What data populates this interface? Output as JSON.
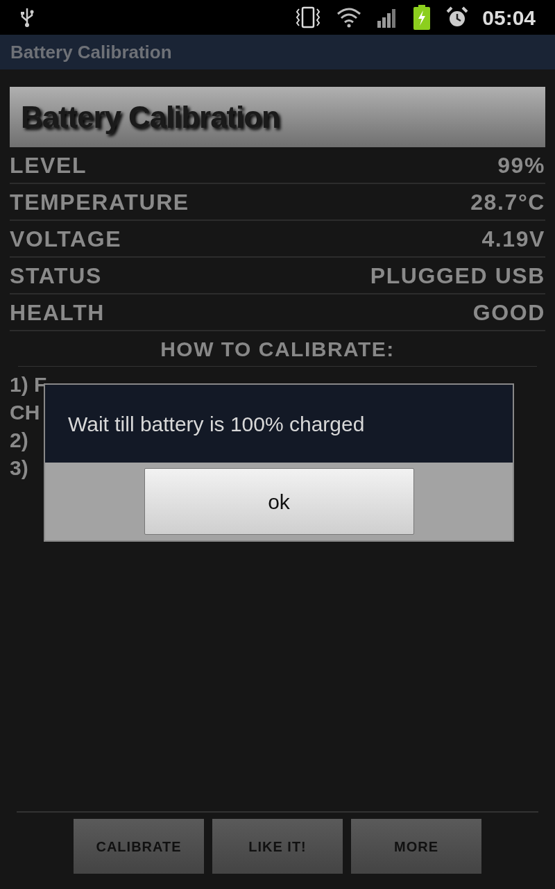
{
  "status_bar": {
    "time": "05:04"
  },
  "window": {
    "title": "Battery Calibration"
  },
  "header": {
    "title": "Battery Calibration"
  },
  "stats": [
    {
      "label": "LEVEL",
      "value": "99%"
    },
    {
      "label": "TEMPERATURE",
      "value": "28.7°C"
    },
    {
      "label": "VOLTAGE",
      "value": "4.19V"
    },
    {
      "label": "STATUS",
      "value": "PLUGGED USB"
    },
    {
      "label": "HEALTH",
      "value": "GOOD"
    }
  ],
  "instructions": {
    "heading": "HOW TO CALIBRATE:",
    "lines": [
      "1) F",
      "CH",
      "2)",
      "3)"
    ]
  },
  "dialog": {
    "message": "Wait till battery is 100% charged",
    "button": "ok"
  },
  "buttons": [
    "CALIBRATE",
    "LIKE IT!",
    "MORE"
  ]
}
